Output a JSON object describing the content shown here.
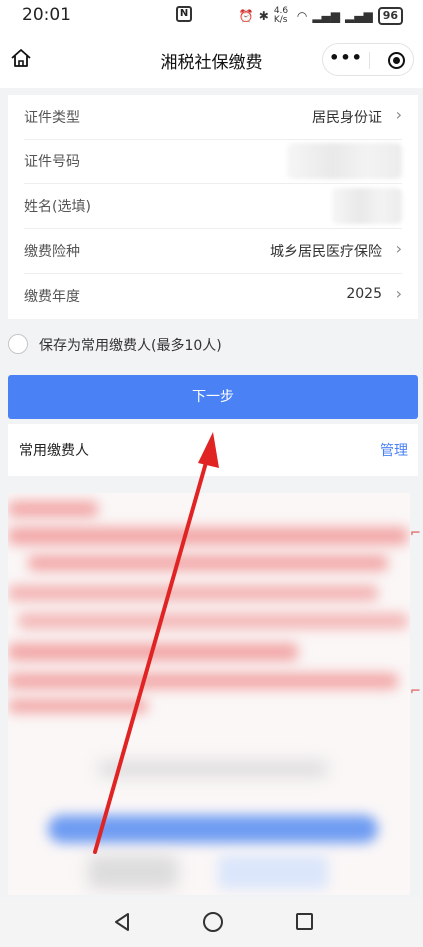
{
  "status_bar": {
    "time": "20:01",
    "nfc_label": "N",
    "net_speed": "4.6 K/s",
    "battery": "96"
  },
  "nav": {
    "title": "湘税社保缴费",
    "more_glyph": "•••"
  },
  "form": {
    "rows": [
      {
        "label": "证件类型",
        "value": "居民身份证",
        "chevron": "›"
      },
      {
        "label": "证件号码",
        "value": ""
      },
      {
        "label": "姓名(选填)",
        "value": ""
      },
      {
        "label": "缴费险种",
        "value": "城乡居民医疗保险",
        "chevron": "›"
      },
      {
        "label": "缴费年度",
        "value": "2025",
        "chevron": "›"
      }
    ]
  },
  "save_payer": {
    "label": "保存为常用缴费人(最多10人)",
    "checked": false
  },
  "next_button": {
    "label": "下一步",
    "color": "#4a82f6"
  },
  "common_payers": {
    "title": "常用缴费人",
    "manage_label": "管理"
  },
  "colors": {
    "accent": "#4a82f6",
    "annotation_arrow": "#e02424"
  },
  "icons": {
    "home": "home-icon",
    "more": "more-dots-icon",
    "target": "target-icon",
    "back": "back-triangle-icon",
    "sys_home": "circle-home-icon",
    "recent": "square-recent-icon"
  }
}
